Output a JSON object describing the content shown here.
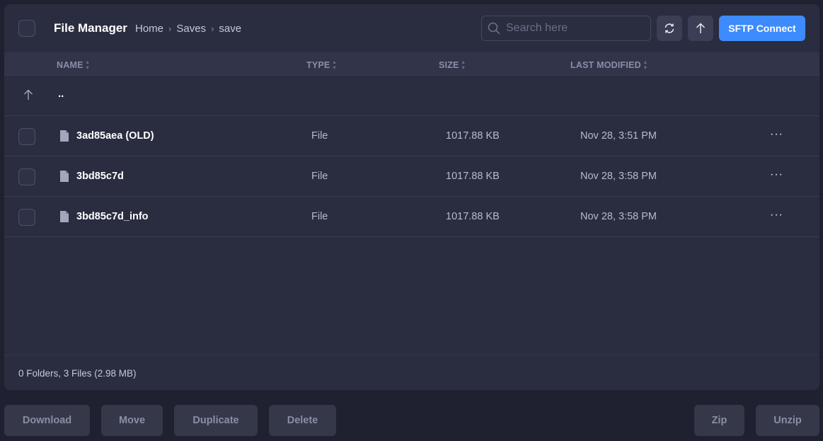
{
  "header": {
    "title": "File Manager",
    "breadcrumbs": [
      "Home",
      "Saves",
      "save"
    ],
    "search_placeholder": "Search here",
    "sftp_label": "SFTP Connect"
  },
  "columns": {
    "name": "NAME",
    "type": "TYPE",
    "size": "SIZE",
    "modified": "LAST MODIFIED"
  },
  "parent_label": "..",
  "files": [
    {
      "name": "3ad85aea (OLD)",
      "type": "File",
      "size": "1017.88 KB",
      "modified": "Nov 28, 3:51 PM"
    },
    {
      "name": "3bd85c7d",
      "type": "File",
      "size": "1017.88 KB",
      "modified": "Nov 28, 3:58 PM"
    },
    {
      "name": "3bd85c7d_info",
      "type": "File",
      "size": "1017.88 KB",
      "modified": "Nov 28, 3:58 PM"
    }
  ],
  "more_label": "···",
  "footer": {
    "summary": "0 Folders, 3 Files (2.98 MB)"
  },
  "actions": {
    "download": "Download",
    "move": "Move",
    "duplicate": "Duplicate",
    "delete": "Delete",
    "zip": "Zip",
    "unzip": "Unzip"
  },
  "colors": {
    "accent": "#3d8bfd",
    "panel": "#2a2d3f",
    "background": "#1f2130"
  },
  "icons": [
    "search-icon",
    "refresh-icon",
    "upload-icon",
    "sort-icon",
    "arrow-up-icon",
    "file-icon",
    "more-icon",
    "chevron-right-icon"
  ]
}
